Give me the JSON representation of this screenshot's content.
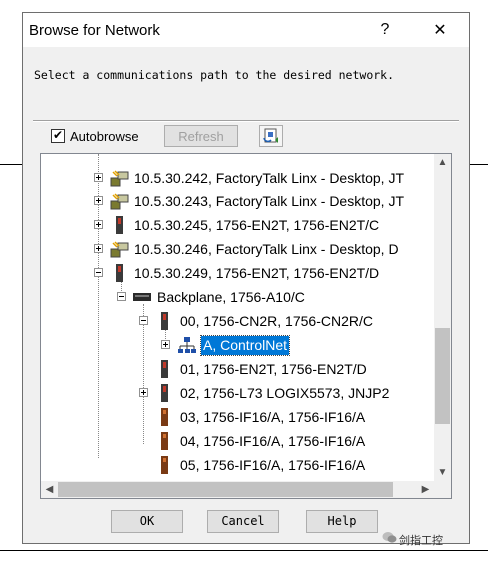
{
  "dialog": {
    "title": "Browse for Network",
    "help_label": "?",
    "close_label": "✕",
    "instruction": "Select a communications path to the desired network.",
    "autobrowse_label": "Autobrowse",
    "autobrowse_checked": "✔",
    "refresh_label": "Refresh"
  },
  "tree": {
    "items": [
      {
        "label": "10.5.30.242, FactoryTalk Linx - Desktop, JT",
        "icon": "workstation-icon"
      },
      {
        "label": "10.5.30.243, FactoryTalk Linx - Desktop, JT",
        "icon": "workstation-icon"
      },
      {
        "label": "10.5.30.245, 1756-EN2T, 1756-EN2T/C",
        "icon": "module-icon"
      },
      {
        "label": "10.5.30.246, FactoryTalk Linx - Desktop, D",
        "icon": "workstation-icon"
      },
      {
        "label": "10.5.30.249, 1756-EN2T, 1756-EN2T/D",
        "icon": "module-icon"
      },
      {
        "label": "Backplane, 1756-A10/C",
        "icon": "backplane-icon"
      },
      {
        "label": "00, 1756-CN2R, 1756-CN2R/C",
        "icon": "module-icon"
      },
      {
        "label": "A, ControlNet",
        "icon": "network-icon"
      },
      {
        "label": "01, 1756-EN2T, 1756-EN2T/D",
        "icon": "module-icon"
      },
      {
        "label": "02, 1756-L73 LOGIX5573, JNJP2",
        "icon": "module-icon"
      },
      {
        "label": "03, 1756-IF16/A, 1756-IF16/A",
        "icon": "io-module-icon"
      },
      {
        "label": "04, 1756-IF16/A, 1756-IF16/A",
        "icon": "io-module-icon"
      },
      {
        "label": "05, 1756-IF16/A, 1756-IF16/A",
        "icon": "io-module-icon"
      }
    ]
  },
  "buttons": {
    "ok": "OK",
    "cancel": "Cancel",
    "help": "Help"
  },
  "watermark": "剑指工控",
  "colors": {
    "selection": "#0078d7",
    "dialog_bg": "#f0f0f0"
  }
}
